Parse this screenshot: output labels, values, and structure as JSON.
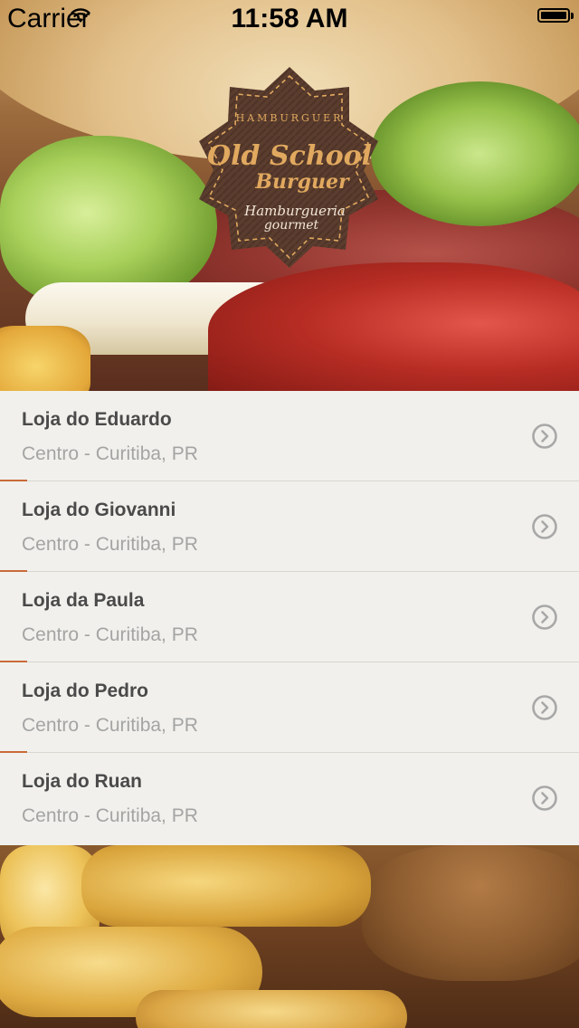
{
  "status_bar": {
    "carrier": "Carrier",
    "time": "11:58 AM",
    "wifi_icon": "wifi-icon",
    "battery_level": 1.0
  },
  "logo": {
    "top_text": "HAMBURGUER",
    "title_line1": "Old School",
    "title_line2": "Burguer",
    "subtitle_line1": "Hamburgueria",
    "subtitle_line2": "gourmet",
    "badge_color": "#5a3d2e",
    "text_color": "#e1a95f"
  },
  "stores": [
    {
      "name": "Loja do Eduardo",
      "location": "Centro - Curitiba, PR",
      "icon": "chevron-right-circle-icon"
    },
    {
      "name": "Loja do Giovanni",
      "location": "Centro - Curitiba, PR",
      "icon": "chevron-right-circle-icon"
    },
    {
      "name": "Loja da Paula",
      "location": "Centro - Curitiba, PR",
      "icon": "chevron-right-circle-icon"
    },
    {
      "name": "Loja do Pedro",
      "location": "Centro - Curitiba, PR",
      "icon": "chevron-right-circle-icon"
    },
    {
      "name": "Loja do Ruan",
      "location": "Centro - Curitiba, PR",
      "icon": "chevron-right-circle-icon"
    }
  ],
  "colors": {
    "list_background": "#f1f0ec",
    "store_name": "#4a4a4a",
    "store_location": "#a4a4a4",
    "chevron": "#a8a8a8",
    "accent": "#c96b3a"
  }
}
